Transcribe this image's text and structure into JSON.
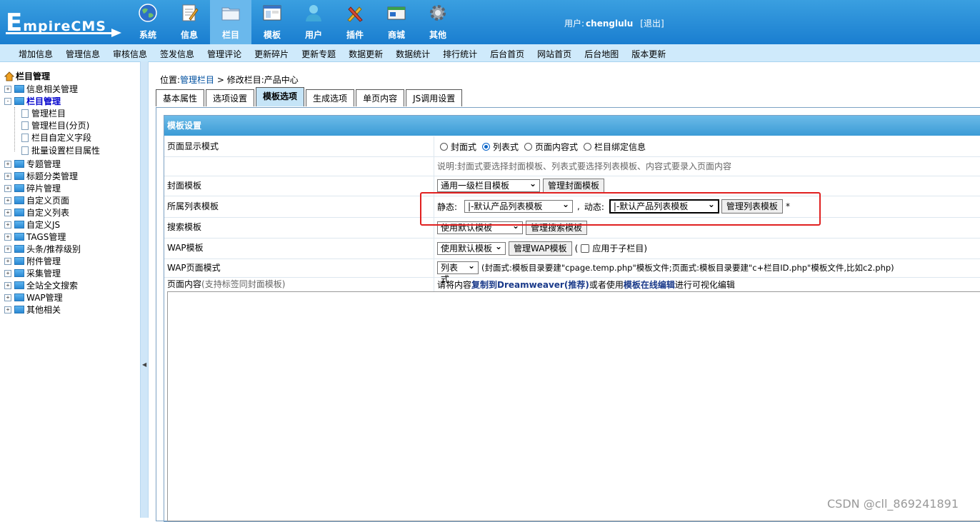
{
  "app": {
    "logo_big": "E",
    "logo_rest": "mpireCMS",
    "user_label": "用户:",
    "user_name": "chenglulu",
    "logout": "[退出]"
  },
  "nav": [
    {
      "label": "系统",
      "icon": "globe-icon"
    },
    {
      "label": "信息",
      "icon": "document-edit-icon"
    },
    {
      "label": "栏目",
      "icon": "folder-icon",
      "active": true
    },
    {
      "label": "模板",
      "icon": "window-template-icon"
    },
    {
      "label": "用户",
      "icon": "user-icon"
    },
    {
      "label": "插件",
      "icon": "tools-icon"
    },
    {
      "label": "商城",
      "icon": "shop-card-icon"
    },
    {
      "label": "其他",
      "icon": "gear-icon"
    }
  ],
  "subbar": [
    "增加信息",
    "管理信息",
    "审核信息",
    "签发信息",
    "管理评论",
    "更新碎片",
    "更新专题",
    "数据更新",
    "数据统计",
    "排行统计",
    "后台首页",
    "网站首页",
    "后台地图",
    "版本更新"
  ],
  "tree": {
    "root": "栏目管理",
    "nodes": [
      {
        "label": "信息相关管理",
        "sign": "+"
      },
      {
        "label": "栏目管理",
        "sign": "-",
        "selected": true
      },
      {
        "label": "专题管理",
        "sign": "+"
      },
      {
        "label": "标题分类管理",
        "sign": "+"
      },
      {
        "label": "碎片管理",
        "sign": "+"
      },
      {
        "label": "自定义页面",
        "sign": "+"
      },
      {
        "label": "自定义列表",
        "sign": "+"
      },
      {
        "label": "自定义JS",
        "sign": "+"
      },
      {
        "label": "TAGS管理",
        "sign": "+"
      },
      {
        "label": "头条/推荐级别",
        "sign": "+"
      },
      {
        "label": "附件管理",
        "sign": "+"
      },
      {
        "label": "采集管理",
        "sign": "+"
      },
      {
        "label": "全站全文搜索",
        "sign": "+"
      },
      {
        "label": "WAP管理",
        "sign": "+"
      },
      {
        "label": "其他相关",
        "sign": "+"
      }
    ],
    "children": [
      "管理栏目",
      "管理栏目(分页)",
      "栏目自定义字段",
      "批量设置栏目属性"
    ]
  },
  "breadcrumb": {
    "prefix": "位置:",
    "link": "管理栏目",
    "rest": " > 修改栏目:产品中心"
  },
  "tabs": [
    "基本属性",
    "选项设置",
    "模板选项",
    "生成选项",
    "单页内容",
    "JS调用设置"
  ],
  "active_tab": "模板选项",
  "form": {
    "header": "模板设置",
    "display_mode": {
      "label": "页面显示模式",
      "options": [
        "封面式",
        "列表式",
        "页面内容式",
        "栏目绑定信息"
      ],
      "selected": "列表式",
      "note": "说明:封面式要选择封面模板、列表式要选择列表模板、内容式要录入页面内容"
    },
    "cover": {
      "label": "封面模板",
      "select": "通用一级栏目模板",
      "button": "管理封面模板"
    },
    "list": {
      "label": "所属列表模板",
      "static_label": "静态:",
      "static_select": "|-默认产品列表模板",
      "comma": ",",
      "dynamic_label": "动态:",
      "dynamic_select": "|-默认产品列表模板",
      "button": "管理列表模板",
      "star": "*"
    },
    "search": {
      "label": "搜索模板",
      "select": "使用默认模板",
      "button": "管理搜索模板"
    },
    "wap": {
      "label": "WAP模板",
      "select": "使用默认模板",
      "button": "管理WAP模板",
      "paren_open": "(",
      "check_label": "应用于子栏目)"
    },
    "wap_mode": {
      "label": "WAP页面模式",
      "select": "列表式",
      "note": "(封面式:模板目录要建\"cpage.temp.php\"模板文件;页面式:模板目录要建\"c+栏目ID.php\"模板文件,比如c2.php)"
    },
    "page_content": {
      "label_main": "页面内容",
      "label_sub": "(支持标签同封面模板)",
      "t1": "请将内容",
      "t2": "复制到Dreamweaver(推荐)",
      "t3": "或者使用",
      "t4": "模板在线编辑",
      "t5": "进行可视化编辑"
    }
  },
  "watermark": "CSDN @cll_869241891",
  "colors": {
    "header": "#1a7ed0",
    "active_nav": "#6ab8ec",
    "subbar": "#cfeafb",
    "form_head": "#3b9bd6",
    "highlight": "#e02020"
  }
}
